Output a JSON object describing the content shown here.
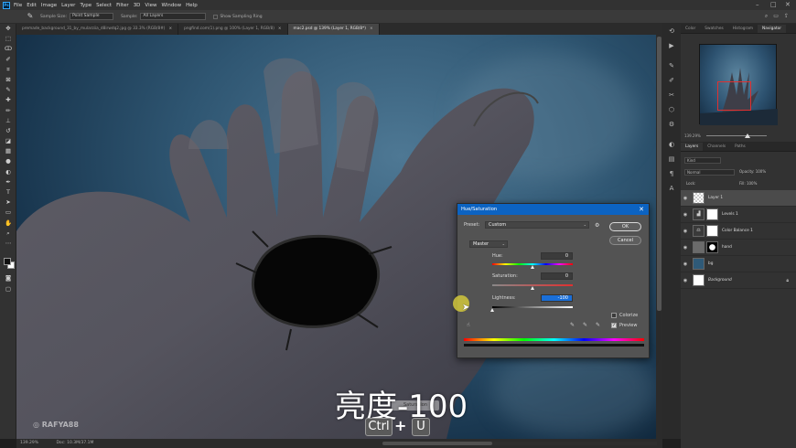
{
  "menubar": {
    "logo": "Ps",
    "items": [
      "File",
      "Edit",
      "Image",
      "Layer",
      "Type",
      "Select",
      "Filter",
      "3D",
      "View",
      "Window",
      "Help"
    ],
    "window_controls": [
      "–",
      "□",
      "✕"
    ]
  },
  "options_bar": {
    "tool_icon": "eyedropper-icon",
    "sample_size_label": "Sample Size:",
    "sample_size_value": "Point Sample",
    "sample_label": "Sample:",
    "sample_value": "All Layers",
    "show_ring_label": "Show Sampling Ring"
  },
  "document_tabs": [
    {
      "title": "premade_background_31_by_mularziia_d8irwdq2.jpg @ 33.3% (RGB/8#)",
      "active": false
    },
    {
      "title": "pngfind.com(1).png @ 100% (Layer 1, RGB/8)",
      "active": false
    },
    {
      "title": "mac2.psd @ 139% (Layer 1, RGB/8*)",
      "active": true
    }
  ],
  "status": {
    "zoom": "139.29%",
    "doc": "Doc: 10.3M/37.1M"
  },
  "panels": {
    "top_tabs": [
      "Color",
      "Swatches",
      "Histogram",
      "Navigator"
    ],
    "active_top_tab": "Navigator",
    "nav_zoom": "139.29%",
    "layer_tabs": [
      "Layers",
      "Channels",
      "Paths"
    ],
    "kind_label": "Kind",
    "blend_mode": "Normal",
    "opacity_label": "Opacity: 100%",
    "fill_label": "Fill: 100%",
    "lock_label": "Lock:",
    "layers": [
      {
        "name": "Layer 1",
        "selected": true,
        "mask": false
      },
      {
        "name": "Levels 1",
        "selected": false,
        "mask": true
      },
      {
        "name": "Color Balance 1",
        "selected": false,
        "mask": true
      },
      {
        "name": "hand",
        "selected": false,
        "mask": true
      },
      {
        "name": "bg",
        "selected": false,
        "mask": false
      },
      {
        "name": "Background",
        "selected": false,
        "mask": false
      }
    ]
  },
  "dialog": {
    "title": "Hue/Saturation",
    "preset_label": "Preset:",
    "preset_value": "Custom",
    "channel_value": "Master",
    "ok_label": "OK",
    "cancel_label": "Cancel",
    "hue_label": "Hue:",
    "hue_value": "0",
    "saturation_label": "Saturation:",
    "saturation_value": "0",
    "lightness_label": "Lightness:",
    "lightness_value": "-100",
    "colorize_label": "Colorize",
    "preview_label": "Preview",
    "colorize_checked": false,
    "preview_checked": true,
    "hue_slider_fraction": 0.5,
    "saturation_slider_fraction": 0.5,
    "lightness_slider_fraction": 0.0
  },
  "overlay": {
    "caption": "亮度-100",
    "tooltip_ghost": "Saturation",
    "keys": [
      "Ctrl",
      "+",
      "U"
    ],
    "watermark": "◎ RAFYA88"
  }
}
